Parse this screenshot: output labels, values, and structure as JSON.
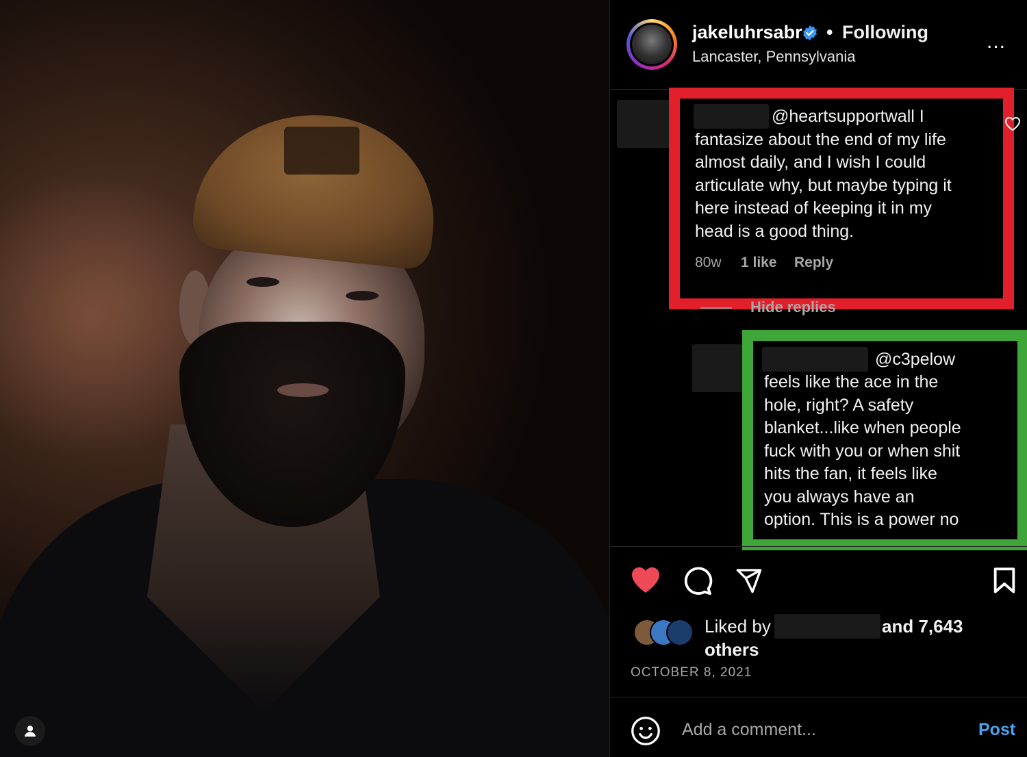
{
  "post": {
    "username": "jakeluhrsabr",
    "separator": "•",
    "follow_status": "Following",
    "location": "Lancaster, Pennsylvania",
    "more_label": "..."
  },
  "comments": [
    {
      "mention": "@heartsupportwall I",
      "lines": [
        "fantasize about the end of my life",
        "almost daily, and I wish I could",
        "articulate why, but maybe typing it",
        "here instead of keeping it in my",
        "head is a good thing."
      ],
      "age": "80w",
      "likes": "1 like",
      "reply_label": "Reply",
      "highlight_color": "#e1202c"
    },
    {
      "mention": "@c3pelow",
      "lines": [
        "feels like the ace in the",
        "hole, right? A safety",
        "blanket...like when people",
        "fuck with you or when shit",
        "hits the fan, it feels like",
        "you always have an",
        "option. This is a power no"
      ],
      "highlight_color": "#3fa639"
    }
  ],
  "hide_replies_label": "Hide replies",
  "likes": {
    "prefix": "Liked by",
    "count_text": "and 7,643",
    "suffix": "others"
  },
  "date": "OCTOBER 8, 2021",
  "comment_box": {
    "placeholder": "Add a comment...",
    "post_label": "Post"
  },
  "icons": [
    "verified-badge-icon",
    "more-options-icon",
    "heart-outline-icon",
    "heart-filled-icon",
    "comment-icon",
    "share-icon",
    "bookmark-icon",
    "emoji-icon",
    "user-tag-icon"
  ],
  "colors": {
    "like_red": "#ed4956",
    "post_blue": "#4aa3f0",
    "verified_blue": "#3897f0"
  }
}
